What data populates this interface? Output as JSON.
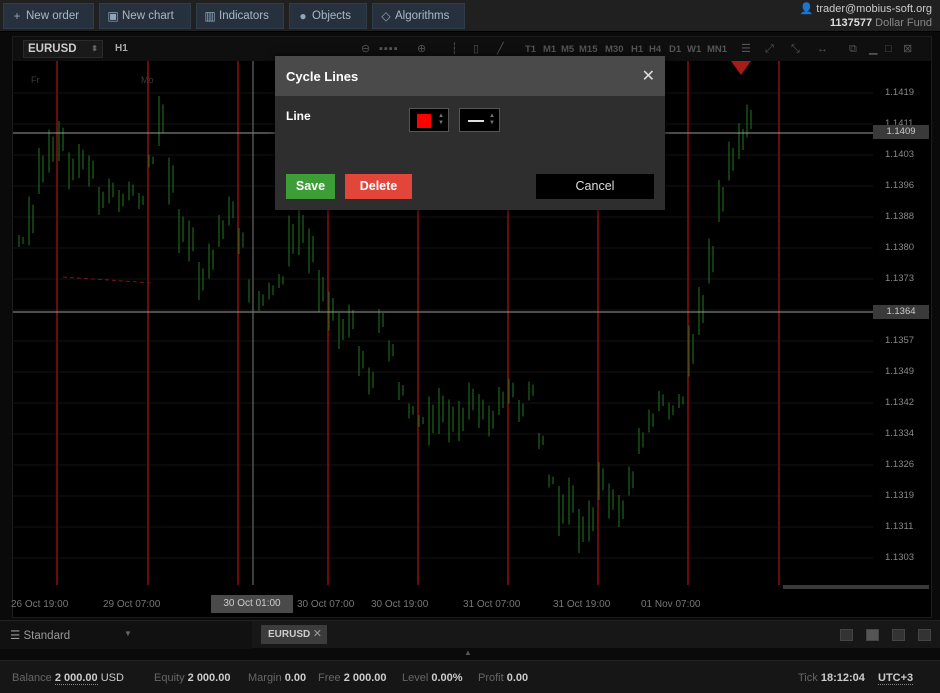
{
  "toolbar": {
    "new_order": "New order",
    "new_chart": "New chart",
    "indicators": "Indicators",
    "objects": "Objects",
    "algorithms": "Algorithms"
  },
  "account": {
    "user": "trader@mobius-soft.org",
    "number": "1137577",
    "fund": "Dollar Fund"
  },
  "chart": {
    "symbol": "EURUSD",
    "timeframe": "H1",
    "timeframes": [
      "T1",
      "M1",
      "M5",
      "M15",
      "M30",
      "H1",
      "H4",
      "D1",
      "W1",
      "MN1"
    ],
    "price_labels": [
      "1.1419",
      "1.1411",
      "1.1403",
      "1.1396",
      "1.1388",
      "1.1380",
      "1.1373",
      "1.1364",
      "1.1357",
      "1.1349",
      "1.1342",
      "1.1334",
      "1.1326",
      "1.1319",
      "1.1311",
      "1.1303"
    ],
    "price_tag_upper": "1.1409",
    "price_tag_lower": "1.1364",
    "time_labels": [
      "26 Oct 19:00",
      "29 Oct 07:00",
      "30 Oct 07:00",
      "30 Oct 19:00",
      "31 Oct 07:00",
      "31 Oct 19:00",
      "01 Nov 07:00"
    ],
    "cursor_time": "30 Oct 01:00",
    "day_labels": [
      "Fr",
      "Mo"
    ],
    "colors": {
      "candle": "#1f7a1f",
      "cycle_line": "#8a1010",
      "crosshair": "#9a9a9a"
    }
  },
  "dialog": {
    "title": "Cycle Lines",
    "line_label": "Line",
    "line_color": "#ff0000",
    "save": "Save",
    "delete": "Delete",
    "cancel": "Cancel"
  },
  "bottom": {
    "workspace": "Standard",
    "tab": "EURUSD"
  },
  "status": {
    "balance_label": "Balance",
    "balance": "2 000.00",
    "currency": "USD",
    "equity_label": "Equity",
    "equity": "2 000.00",
    "margin_label": "Margin",
    "margin": "0.00",
    "free_label": "Free",
    "free": "2 000.00",
    "level_label": "Level",
    "level": "0.00%",
    "profit_label": "Profit",
    "profit": "0.00",
    "tick_label": "Tick",
    "time": "18:12:04",
    "timezone": "UTC+3"
  }
}
